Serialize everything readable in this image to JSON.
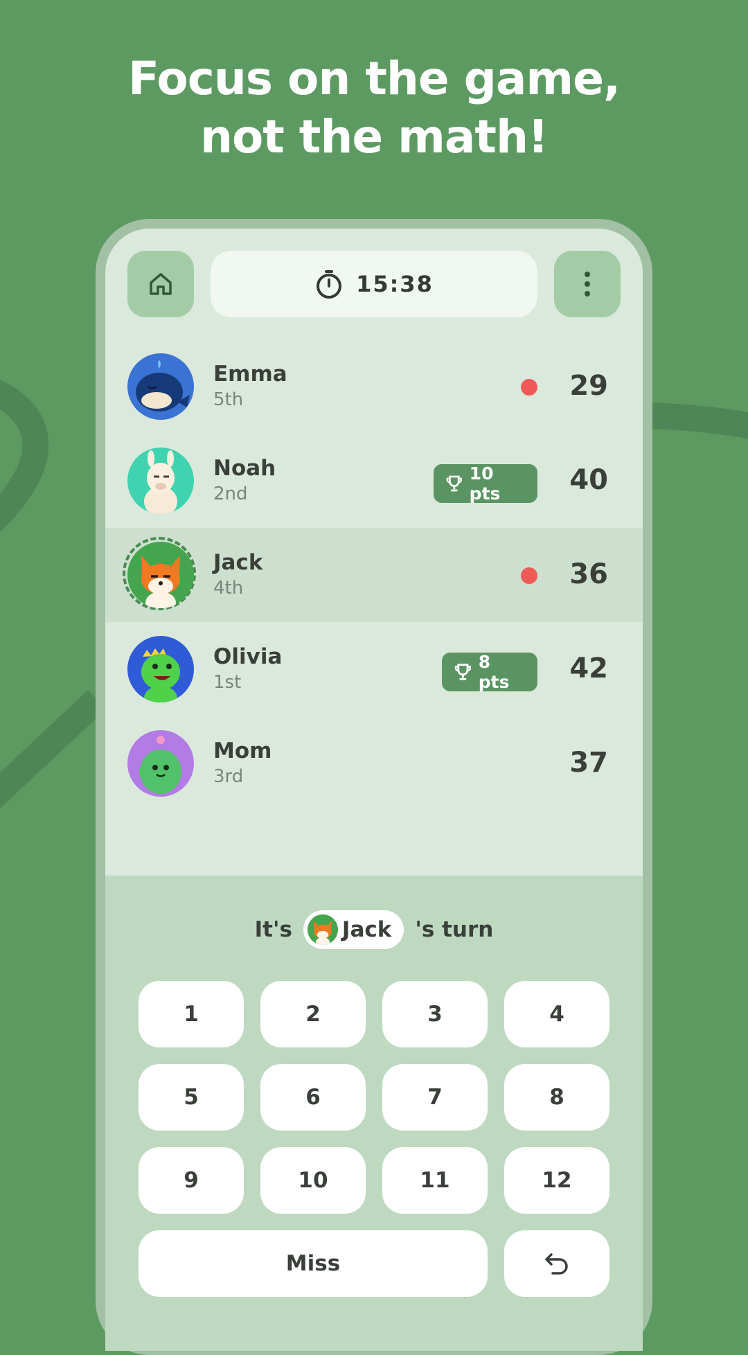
{
  "headline": {
    "line1": "Focus on the game,",
    "line2": "not the math!"
  },
  "topbar": {
    "timer": "15:38"
  },
  "players": [
    {
      "name": "Emma",
      "rank": "5th",
      "score": "29",
      "indicator": "dot",
      "avatar": "whale"
    },
    {
      "name": "Noah",
      "rank": "2nd",
      "score": "40",
      "badge": "10 pts",
      "avatar": "llama"
    },
    {
      "name": "Jack",
      "rank": "4th",
      "score": "36",
      "indicator": "dot",
      "avatar": "fox",
      "active": true
    },
    {
      "name": "Olivia",
      "rank": "1st",
      "score": "42",
      "badge": "8 pts",
      "avatar": "dinosaur"
    },
    {
      "name": "Mom",
      "rank": "3rd",
      "score": "37",
      "avatar": "cactus"
    }
  ],
  "turn": {
    "prefix": "It's",
    "player": "Jack",
    "suffix": "'s turn"
  },
  "keypad": {
    "keys": [
      "1",
      "2",
      "3",
      "4",
      "5",
      "6",
      "7",
      "8",
      "9",
      "10",
      "11",
      "12"
    ],
    "miss": "Miss",
    "undo_icon": "undo-icon"
  },
  "colors": {
    "background": "#5d9a62",
    "badge": "#5a9462",
    "dot": "#ef5a57",
    "active_row": "#cde0cf"
  }
}
